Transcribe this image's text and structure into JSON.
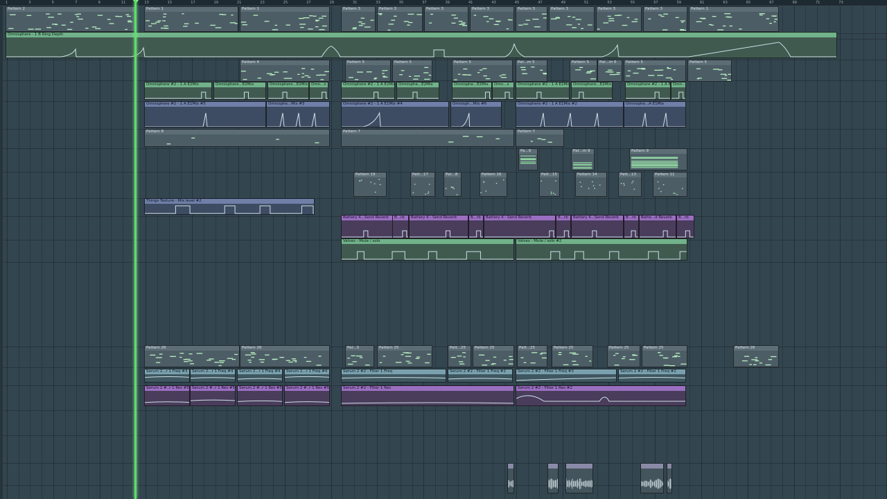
{
  "app": {
    "name": "Playlist",
    "colors": {
      "background": "#33454f",
      "pattern_clip": "#4d5d66",
      "automation_green": "#71b28a",
      "automation_blue": "#6f7fa8",
      "automation_teal": "#7aa0ae",
      "automation_purple": "#9a6fc0",
      "playhead": "#5fdc6a"
    }
  },
  "ruler": {
    "bars": [
      "1",
      "3",
      "5",
      "7",
      "9",
      "11",
      "13",
      "15",
      "17",
      "19",
      "21",
      "23",
      "25",
      "27",
      "29",
      "31",
      "33",
      "35",
      "37",
      "39",
      "41",
      "43",
      "45",
      "47",
      "49",
      "51",
      "53",
      "55",
      "57",
      "59",
      "61",
      "63",
      "65",
      "67",
      "69",
      "71",
      "73"
    ]
  },
  "clips": [
    {
      "id": "p2",
      "label": "Pattern 2",
      "kind": "pattern"
    },
    {
      "id": "p1a",
      "label": "Pattern 1",
      "kind": "pattern"
    },
    {
      "id": "p1b",
      "label": "Pattern 1",
      "kind": "pattern"
    },
    {
      "id": "p3a",
      "label": "Pattern 3",
      "kind": "pattern"
    },
    {
      "id": "p3b",
      "label": "Pattern 3",
      "kind": "pattern"
    },
    {
      "id": "p3c",
      "label": "Pattern 3",
      "kind": "pattern"
    },
    {
      "id": "p3d",
      "label": "Pattern 3",
      "kind": "pattern"
    },
    {
      "id": "p3e",
      "label": "Pattern 3",
      "kind": "pattern"
    },
    {
      "id": "p3f",
      "label": "Pattern 3",
      "kind": "pattern"
    },
    {
      "id": "p3g",
      "label": "Pattern 3",
      "kind": "pattern"
    },
    {
      "id": "p3h",
      "label": "Pattern 3",
      "kind": "pattern"
    },
    {
      "id": "p3i",
      "label": "Pattern 3",
      "kind": "pattern"
    },
    {
      "id": "p1c",
      "label": "Pattern 1",
      "kind": "pattern"
    },
    {
      "id": "ringdepth",
      "label": "Omnisphere - 1 B Ring Depth",
      "kind": "auto-green"
    },
    {
      "id": "p4",
      "label": "Pattern 4",
      "kind": "pattern"
    },
    {
      "id": "p5a",
      "label": "Pattern 5",
      "kind": "pattern"
    },
    {
      "id": "p5b",
      "label": "Pattern 5",
      "kind": "pattern"
    },
    {
      "id": "p5c",
      "label": "Pattern 5",
      "kind": "pattern"
    },
    {
      "id": "pat5",
      "label": "Pat...m 5",
      "kind": "pattern"
    },
    {
      "id": "p5d",
      "label": "Pattern 5",
      "kind": "pattern"
    },
    {
      "id": "pat6",
      "label": "Pat...m 6",
      "kind": "pattern"
    },
    {
      "id": "p5e",
      "label": "Pattern 5",
      "kind": "pattern"
    },
    {
      "id": "p5f",
      "label": "Pattern 5",
      "kind": "pattern"
    },
    {
      "id": "e2a",
      "label": "Omnisphere #2 - 1 A E2Mix",
      "kind": "auto-green"
    },
    {
      "id": "e2b",
      "label": "Omnisphere...E2Mix",
      "kind": "auto-green"
    },
    {
      "id": "e2c",
      "label": "Omnisphere...E2Mix",
      "kind": "auto-green"
    },
    {
      "id": "e2d",
      "label": "Omn...x",
      "kind": "auto-green"
    },
    {
      "id": "e2e",
      "label": "Omnisphere #2 - 1 A E2Mix",
      "kind": "auto-green"
    },
    {
      "id": "e2f",
      "label": "Omnisphe...E2Mix",
      "kind": "auto-green"
    },
    {
      "id": "e2g",
      "label": "Omnisphe...E2Mix",
      "kind": "auto-green"
    },
    {
      "id": "e2h",
      "label": "Omn...x",
      "kind": "auto-green"
    },
    {
      "id": "e2i",
      "label": "Omnisphere #2 - 1 A E2Mix",
      "kind": "auto-green"
    },
    {
      "id": "e2j",
      "label": "Omnisphere...E2Mix",
      "kind": "auto-green"
    },
    {
      "id": "e2k",
      "label": "Omnisphere #2 - 1 A E2Mix",
      "kind": "auto-green"
    },
    {
      "id": "e2l",
      "label": "Omn...x",
      "kind": "auto-green"
    },
    {
      "id": "e1a",
      "label": "Omnisphere #2 - 1 A E1Mix #5",
      "kind": "auto-blue"
    },
    {
      "id": "e1b",
      "label": "Omnisphe...Mix #3",
      "kind": "auto-blue"
    },
    {
      "id": "e1c",
      "label": "Omnisphere #2 - 1 A E1Mix #4",
      "kind": "auto-blue"
    },
    {
      "id": "e1d",
      "label": "Omnisph...Mix #6",
      "kind": "auto-blue"
    },
    {
      "id": "e1e",
      "label": "Omnisphere #2 - 1 A E1Mix #2",
      "kind": "auto-blue"
    },
    {
      "id": "e1f",
      "label": "Omnisphe...A E1Mix",
      "kind": "auto-blue"
    },
    {
      "id": "p8",
      "label": "Pattern 8",
      "kind": "pattern"
    },
    {
      "id": "p7a",
      "label": "Pattern 7",
      "kind": "pattern"
    },
    {
      "id": "p7b",
      "label": "Pattern 7",
      "kind": "pattern"
    },
    {
      "id": "pa9",
      "label": "Pa...9",
      "kind": "pattern"
    },
    {
      "id": "patm9",
      "label": "Pat...m 9",
      "kind": "pattern"
    },
    {
      "id": "p9",
      "label": "Pattern 9",
      "kind": "pattern"
    },
    {
      "id": "p19",
      "label": "Pattern 19",
      "kind": "pattern"
    },
    {
      "id": "patt17",
      "label": "Patt...17",
      "kind": "pattern"
    },
    {
      "id": "pat8",
      "label": "Pat...8",
      "kind": "pattern"
    },
    {
      "id": "p16",
      "label": "Pattern 16",
      "kind": "pattern"
    },
    {
      "id": "patt15",
      "label": "Patt...15",
      "kind": "pattern"
    },
    {
      "id": "p14",
      "label": "Pattern 14",
      "kind": "pattern"
    },
    {
      "id": "patt13",
      "label": "Patt...13",
      "kind": "pattern"
    },
    {
      "id": "p11",
      "label": "Pattern 11",
      "kind": "pattern"
    },
    {
      "id": "things",
      "label": "Things Texture - Mix level #2",
      "kind": "auto-blue"
    },
    {
      "id": "bat1",
      "label": "Battery 4...Send Reverb",
      "kind": "auto-purple"
    },
    {
      "id": "bat2",
      "label": "B...rb",
      "kind": "auto-purple"
    },
    {
      "id": "bat3",
      "label": "Battery 4 - Send Reverb",
      "kind": "auto-purple"
    },
    {
      "id": "bat4",
      "label": "B...rb",
      "kind": "auto-purple"
    },
    {
      "id": "bat5",
      "label": "Battery 4 - Send Reverb",
      "kind": "auto-purple"
    },
    {
      "id": "bat6",
      "label": "B...rb",
      "kind": "auto-purple"
    },
    {
      "id": "bat7",
      "label": "Battery 4...Send Reverb",
      "kind": "auto-purple"
    },
    {
      "id": "bat8",
      "label": "B...rb",
      "kind": "auto-purple"
    },
    {
      "id": "bat9",
      "label": "Batte...d Reverb",
      "kind": "auto-purple"
    },
    {
      "id": "bat10",
      "label": "B...rb",
      "kind": "auto-purple"
    },
    {
      "id": "valves1",
      "label": "Valves - Mute / solo",
      "kind": "auto-green"
    },
    {
      "id": "valves2",
      "label": "Valves - Mute / solo #2",
      "kind": "auto-green"
    },
    {
      "id": "p26a",
      "label": "Pattern 26",
      "kind": "pattern"
    },
    {
      "id": "p26b",
      "label": "Pattern 26",
      "kind": "pattern"
    },
    {
      "id": "pat5b",
      "label": "Pat...5",
      "kind": "pattern"
    },
    {
      "id": "p25a",
      "label": "Pattern 25",
      "kind": "pattern"
    },
    {
      "id": "patt25a",
      "label": "Patt...25",
      "kind": "pattern"
    },
    {
      "id": "p25b",
      "label": "Pattern 25",
      "kind": "pattern"
    },
    {
      "id": "patt25b",
      "label": "Patt...25",
      "kind": "pattern"
    },
    {
      "id": "p25c",
      "label": "Pattern 25",
      "kind": "pattern"
    },
    {
      "id": "p25d",
      "label": "Pattern 25",
      "kind": "pattern"
    },
    {
      "id": "p25e",
      "label": "Pattern 25",
      "kind": "pattern"
    },
    {
      "id": "p26c",
      "label": "Pattern 26",
      "kind": "pattern"
    },
    {
      "id": "sf1",
      "label": "Serum 2...r 1 Freq #3",
      "kind": "auto-teal"
    },
    {
      "id": "sf2",
      "label": "Serum 2...r 1 Freq #4",
      "kind": "auto-teal"
    },
    {
      "id": "sf3",
      "label": "Serum 2...r 1 Freq #4",
      "kind": "auto-teal"
    },
    {
      "id": "sf4",
      "label": "Serum 2...r 1 Freq #4",
      "kind": "auto-teal"
    },
    {
      "id": "sf5",
      "label": "Serum 2 #2 - Filter 1 Freq",
      "kind": "auto-teal"
    },
    {
      "id": "sf6",
      "label": "Serum 2 #2 - Filter 1 Freq #2",
      "kind": "auto-teal"
    },
    {
      "id": "sf7",
      "label": "Serum 2 #2 - Filter 1 Freq #3",
      "kind": "auto-teal"
    },
    {
      "id": "sf8",
      "label": "Serum 2 #2 - Filter 1 Freq #2",
      "kind": "auto-teal"
    },
    {
      "id": "sr1",
      "label": "Serum 2 #..r 1 Res #5",
      "kind": "auto-purple"
    },
    {
      "id": "sr2",
      "label": "Serum 2 #..r 1 Res #5",
      "kind": "auto-purple"
    },
    {
      "id": "sr3",
      "label": "Serum 2 #..r 1 Res #5",
      "kind": "auto-purple"
    },
    {
      "id": "sr4",
      "label": "Serum 2 #..r 1 Res #5",
      "kind": "auto-purple"
    },
    {
      "id": "sr5",
      "label": "Serum 2 #2 - Filter 1 Res",
      "kind": "auto-purple"
    },
    {
      "id": "sr6",
      "label": "Serum 2 #2 - Filter 1 Res #2",
      "kind": "auto-purple"
    }
  ]
}
